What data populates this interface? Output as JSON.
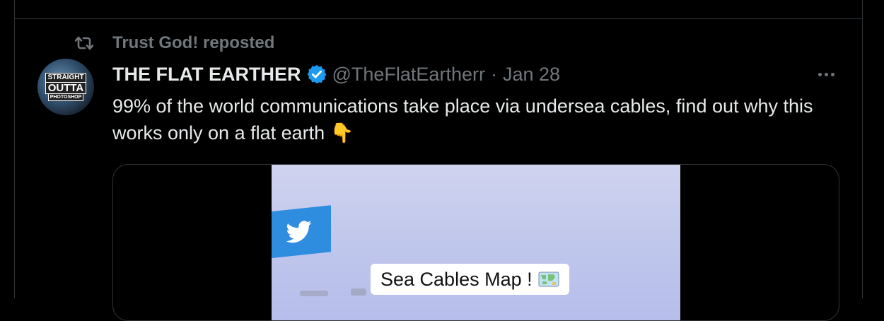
{
  "repost": {
    "label": "Trust God! reposted"
  },
  "author": {
    "name": "THE FLAT EARTHER",
    "handle": "@TheFlatEartherr",
    "separator": "·",
    "date": "Jan 28",
    "avatar_text": [
      "STRAIGHT",
      "OUTTA",
      "PHOTOSHOP"
    ]
  },
  "tweet": {
    "text": "99% of the world communications take place via undersea cables, find out why this works only on a flat earth 👇"
  },
  "media": {
    "caption": "Sea Cables Map !"
  },
  "icons": {
    "repost": "repost-icon",
    "verified": "verified-badge-icon",
    "more": "more-options-icon",
    "twitter": "twitter-bird-icon",
    "map": "map-icon"
  },
  "colors": {
    "background": "#000000",
    "text": "#e7e9ea",
    "secondary": "#71767b",
    "verified": "#1d9bf0",
    "border": "#2f3336"
  }
}
